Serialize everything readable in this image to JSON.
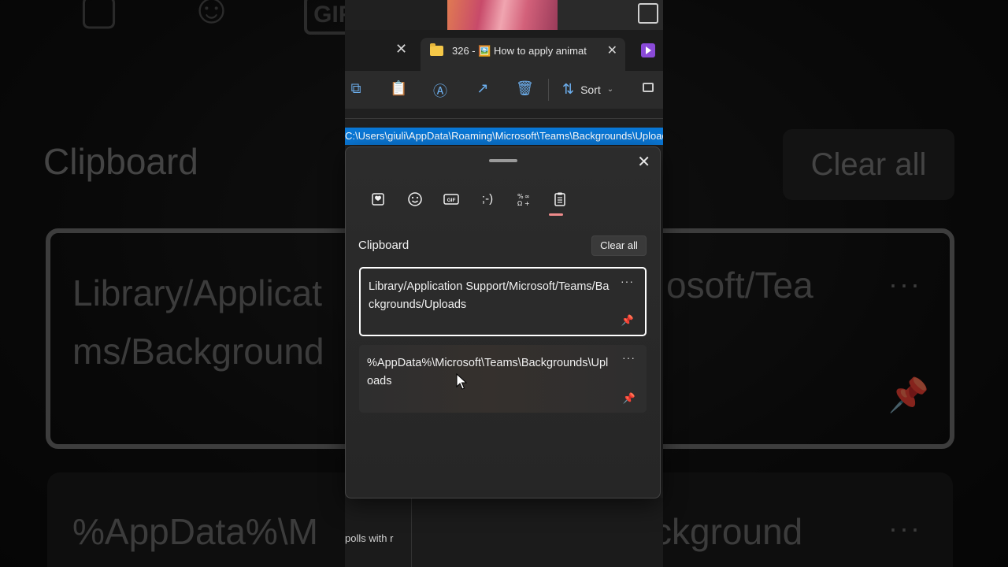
{
  "background": {
    "title": "Clipboard",
    "clear_all": "Clear all",
    "item1_line1": "Library/Applicat",
    "item1_line2": "ms/Background",
    "item1_right": "osoft/Tea",
    "item2_left": "%AppData%\\M",
    "item2_right": "ckground",
    "more_dots": "···",
    "icon_names": [
      "favorites-icon",
      "emoji-icon",
      "gif-icon"
    ]
  },
  "explorer": {
    "tab_label": "326 - 🖼️ How to apply animat",
    "toolbar_icons": [
      "copy-icon",
      "paste-icon",
      "rename-icon",
      "share-icon",
      "delete-icon"
    ],
    "sort_label": "Sort",
    "address_path": "C:\\Users\\giuli\\AppData\\Roaming\\Microsoft\\Teams\\Backgrounds\\Uploads",
    "peek_text": "polls with r"
  },
  "clipboard": {
    "title": "Clipboard",
    "clear_all_label": "Clear all",
    "categories": [
      {
        "name": "favorites",
        "glyph": "♥"
      },
      {
        "name": "emoji",
        "glyph": "☺"
      },
      {
        "name": "gif",
        "glyph": "GIF"
      },
      {
        "name": "kaomoji",
        "glyph": ";-)"
      },
      {
        "name": "symbols",
        "glyph": "Ω"
      },
      {
        "name": "clipboard-history",
        "glyph": "📋"
      }
    ],
    "active_category": "clipboard-history",
    "items": [
      {
        "text": "Library/Application Support/Microsoft/Teams/Backgrounds/Uploads",
        "selected": true
      },
      {
        "text": "%AppData%\\Microsoft\\Teams\\Backgrounds\\Uploads",
        "selected": false
      }
    ],
    "more_label": "···",
    "accent_color": "#ef8b8b"
  }
}
